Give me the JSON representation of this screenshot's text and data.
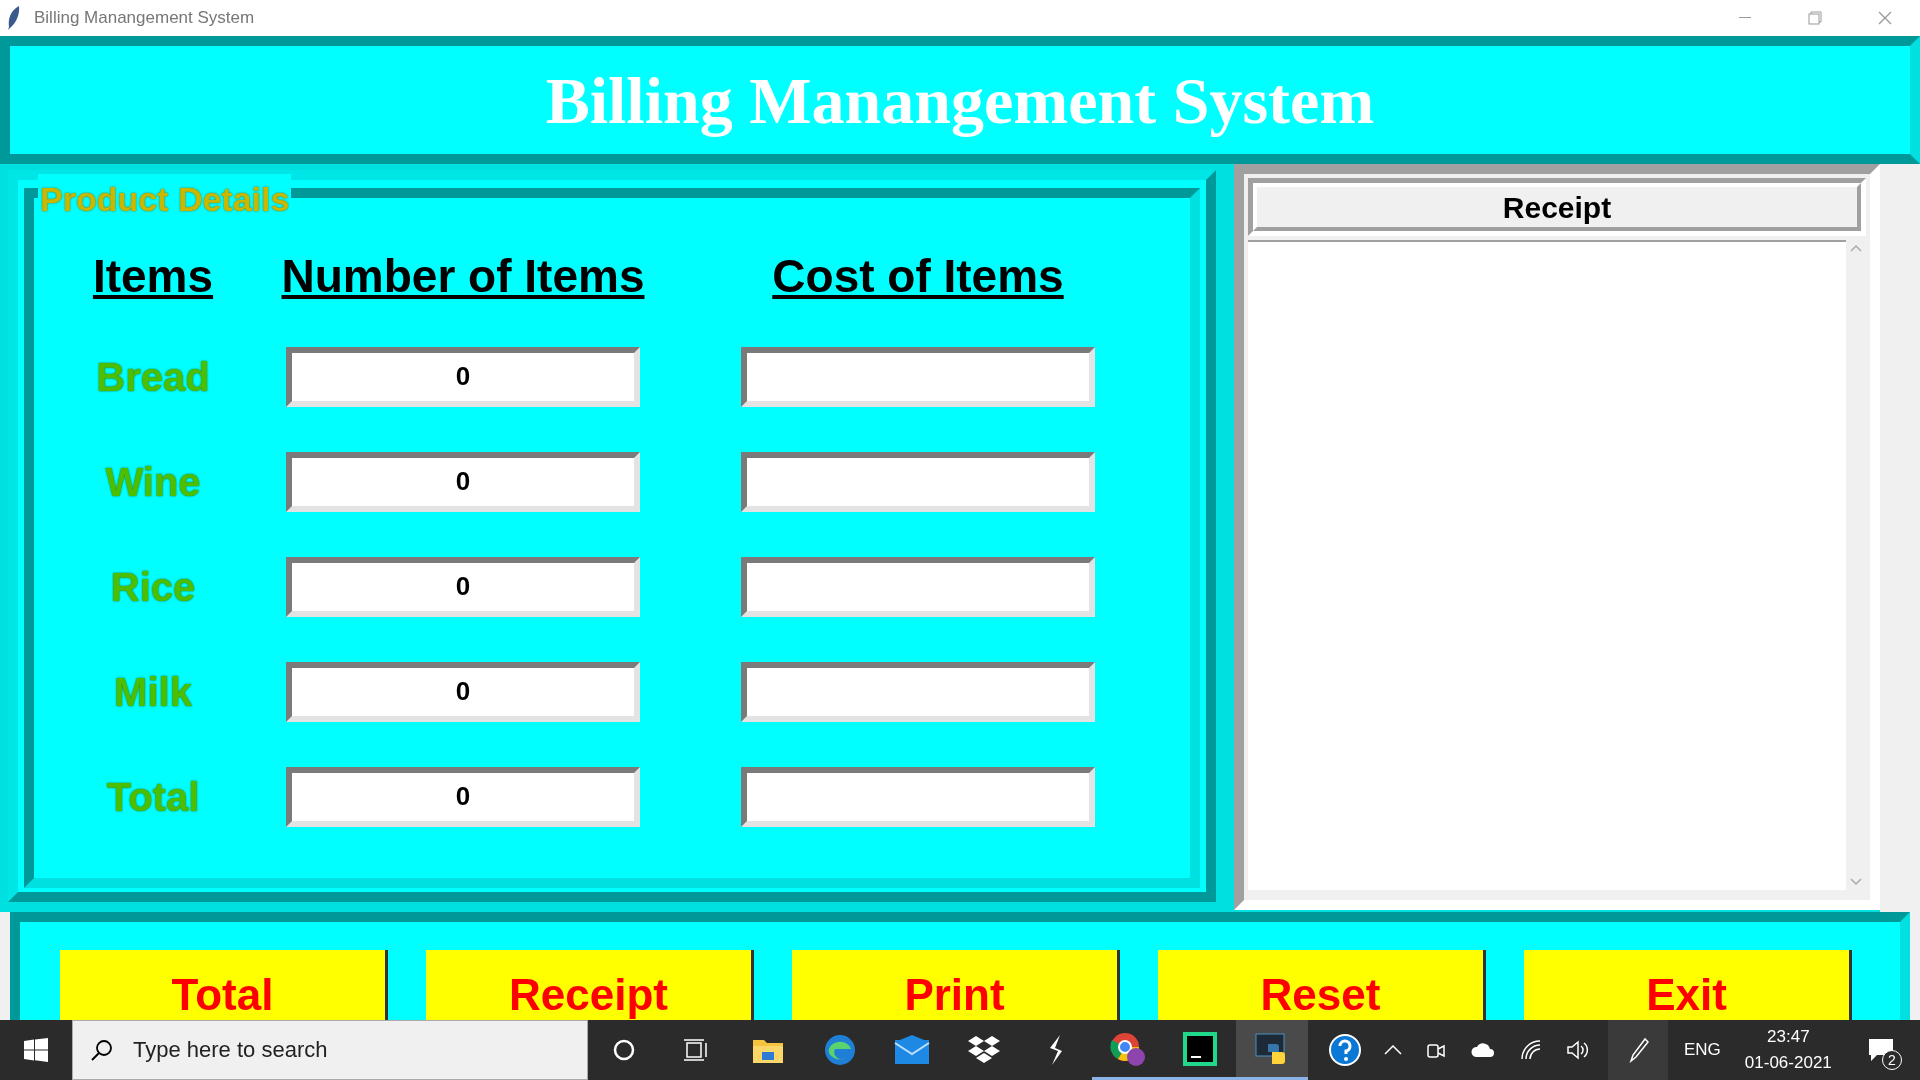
{
  "window": {
    "title": "Billing Manangement System"
  },
  "header": {
    "title": "Billing Manangement System"
  },
  "product_details": {
    "label": "Product Details",
    "columns": [
      "Items",
      "Number of Items",
      "Cost of Items"
    ],
    "rows": [
      {
        "item": "Bread",
        "number": "0"
      },
      {
        "item": "Wine",
        "number": "0"
      },
      {
        "item": "Rice",
        "number": "0"
      },
      {
        "item": "Milk",
        "number": "0"
      },
      {
        "item": "Total",
        "number": "0"
      }
    ]
  },
  "receipt": {
    "title": "Receipt"
  },
  "buttons": [
    "Total",
    "Receipt",
    "Print",
    "Reset",
    "Exit"
  ],
  "taskbar": {
    "search": {
      "placeholder": "Type here to search"
    },
    "apps": [
      {
        "kind": "cortana",
        "running": false,
        "selected": false
      },
      {
        "kind": "taskview",
        "running": false,
        "selected": false
      },
      {
        "kind": "folder",
        "running": false,
        "selected": false
      },
      {
        "kind": "edge",
        "running": false,
        "selected": false
      },
      {
        "kind": "mail",
        "running": false,
        "selected": false
      },
      {
        "kind": "dropbox",
        "running": false,
        "selected": false
      },
      {
        "kind": "bolt",
        "running": false,
        "selected": false
      },
      {
        "kind": "chrome",
        "running": true,
        "selected": false
      },
      {
        "kind": "pycharm",
        "running": true,
        "selected": false
      },
      {
        "kind": "python",
        "running": true,
        "selected": true
      }
    ],
    "language": "ENG",
    "time": "23:47",
    "date": "01-06-2021",
    "notifications": "2"
  }
}
